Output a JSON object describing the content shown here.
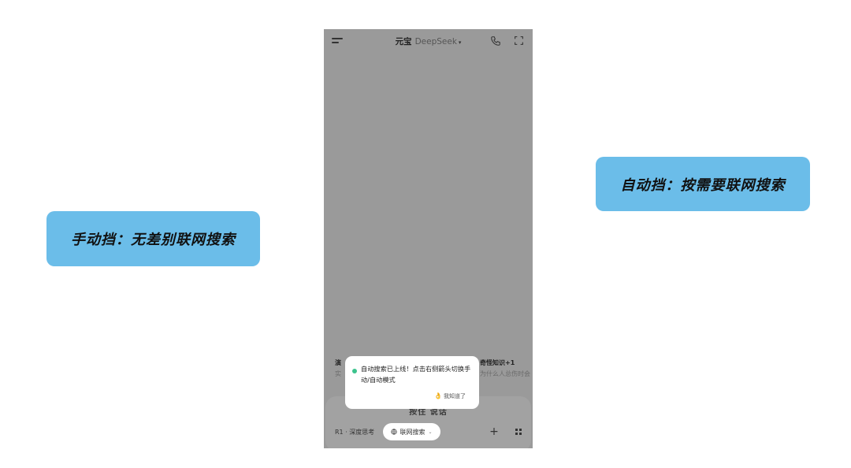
{
  "callouts": {
    "left": "手动挡：无差别联网搜索",
    "right": "自动挡：按需要联网搜索"
  },
  "app": {
    "title": "元宝",
    "model": "DeepSeek",
    "model_caret": "▾",
    "menu_icon": "menu-icon",
    "call_icon": "phone-icon",
    "new_chat_icon": "new-chat-icon"
  },
  "suggestions": {
    "left": {
      "title": "演",
      "sub": "实"
    },
    "right": {
      "title": "奇怪知识+1",
      "sub": "为什么人总伤时会"
    }
  },
  "input": {
    "placeholder": "按住 说话"
  },
  "toolbar": {
    "deep_think": "R1 · 深度思考",
    "web_search": "联网搜索",
    "web_search_caret": "⌄",
    "plus": "+",
    "apps_icon": "grid-icon"
  },
  "popup": {
    "message": "自动搜索已上线！点击右侧箭头切换手动/自动模式",
    "ack": "我知道了",
    "ack_icon": "👌",
    "dot_color": "#3cc38d"
  },
  "colors": {
    "callout_bg": "#6bbde9",
    "overlay": "#9a9a9a"
  }
}
